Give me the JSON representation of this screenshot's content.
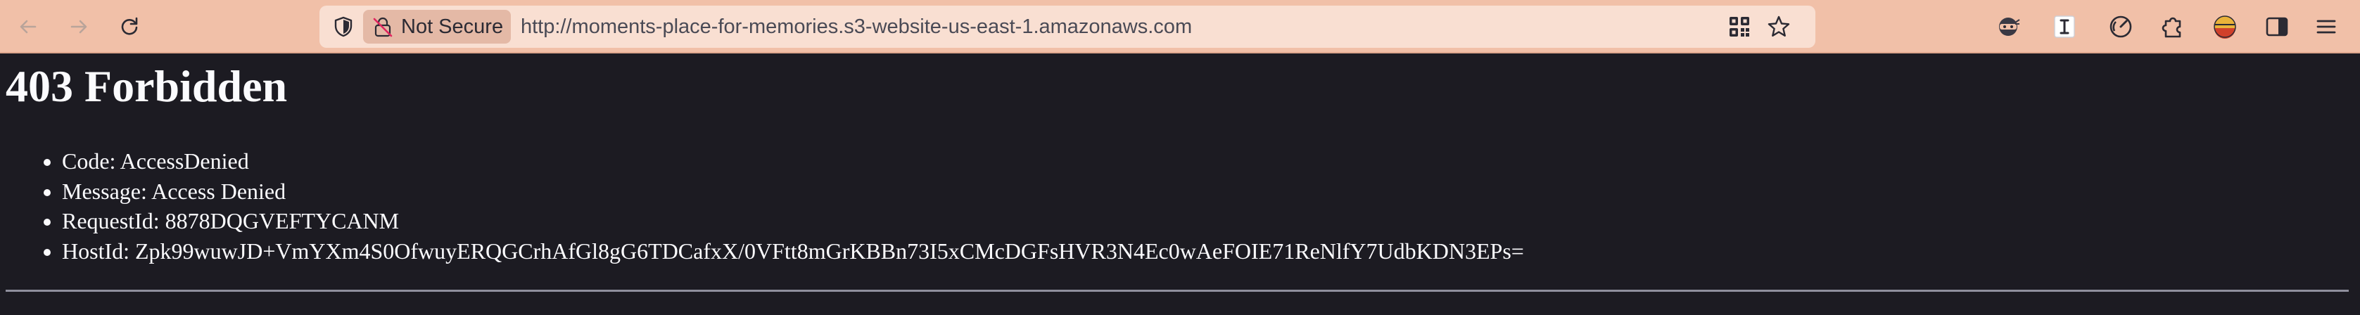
{
  "browser": {
    "security_label": "Not Secure",
    "url": "http://moments-place-for-memories.s3-website-us-east-1.amazonaws.com",
    "icons": {
      "back": "arrow-left-icon",
      "forward": "arrow-right-icon",
      "reload": "reload-icon",
      "shield": "shield-icon",
      "insecure_lock": "insecure-lock-icon",
      "qr": "qr-code-icon",
      "bookmark": "star-icon",
      "extensions": [
        "ninja-extension-icon",
        "i-extension-icon",
        "speed-dial-icon",
        "extensions-puzzle-icon",
        "profile-icon",
        "sidebar-icon",
        "menu-icon"
      ]
    },
    "colors": {
      "toolbar": "#f1c0a8",
      "urlbar": "#f9dfd2",
      "page_background": "#1c1b22",
      "page_text": "#fbfbfe"
    }
  },
  "page": {
    "heading": "403 Forbidden",
    "items": [
      "Code: AccessDenied",
      "Message: Access Denied",
      "RequestId: 8878DQGVEFTYCANM",
      "HostId: Zpk99wuwJD+VmYXm4S0OfwuyERQGCrhAfGl8gG6TDCafxX/0VFtt8mGrKBBn73I5xCMcDGFsHVR3N4Ec0wAeFOIE71ReNlfY7UdbKDN3EPs="
    ]
  }
}
